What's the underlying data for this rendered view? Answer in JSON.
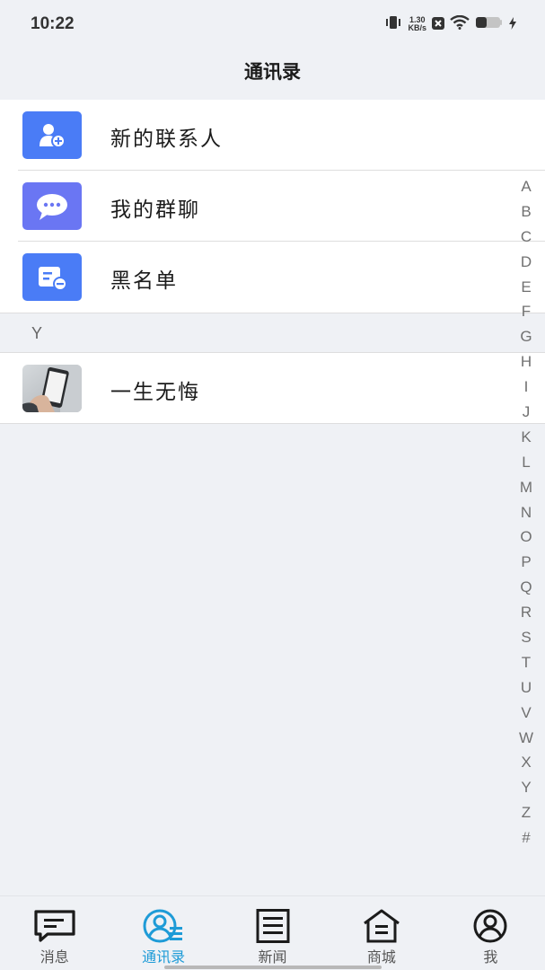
{
  "status_bar": {
    "time": "10:22",
    "net_speed_value": "1.30",
    "net_speed_unit": "KB/s"
  },
  "header": {
    "title": "通讯录"
  },
  "menu": [
    {
      "label": "新的联系人",
      "icon": "add-contact-icon",
      "color": "#4a7cf6"
    },
    {
      "label": "我的群聊",
      "icon": "chat-bubble-icon",
      "color": "#6a76f3"
    },
    {
      "label": "黑名单",
      "icon": "blacklist-icon",
      "color": "#4a7cf6"
    }
  ],
  "section": {
    "letter": "Y"
  },
  "contacts": [
    {
      "name": "一生无悔",
      "avatar": "phone-photo-avatar"
    }
  ],
  "index_letters": [
    "A",
    "B",
    "C",
    "D",
    "E",
    "F",
    "G",
    "H",
    "I",
    "J",
    "K",
    "L",
    "M",
    "N",
    "O",
    "P",
    "Q",
    "R",
    "S",
    "T",
    "U",
    "V",
    "W",
    "X",
    "Y",
    "Z",
    "#"
  ],
  "tabs": [
    {
      "label": "消息",
      "icon": "message-icon",
      "active": false
    },
    {
      "label": "通讯录",
      "icon": "contacts-icon",
      "active": true
    },
    {
      "label": "新闻",
      "icon": "news-icon",
      "active": false
    },
    {
      "label": "商城",
      "icon": "store-icon",
      "active": false
    },
    {
      "label": "我",
      "icon": "profile-icon",
      "active": false
    }
  ],
  "colors": {
    "accent": "#1e9bd7",
    "background": "#eff1f5",
    "icon_blue": "#4a7cf6"
  }
}
